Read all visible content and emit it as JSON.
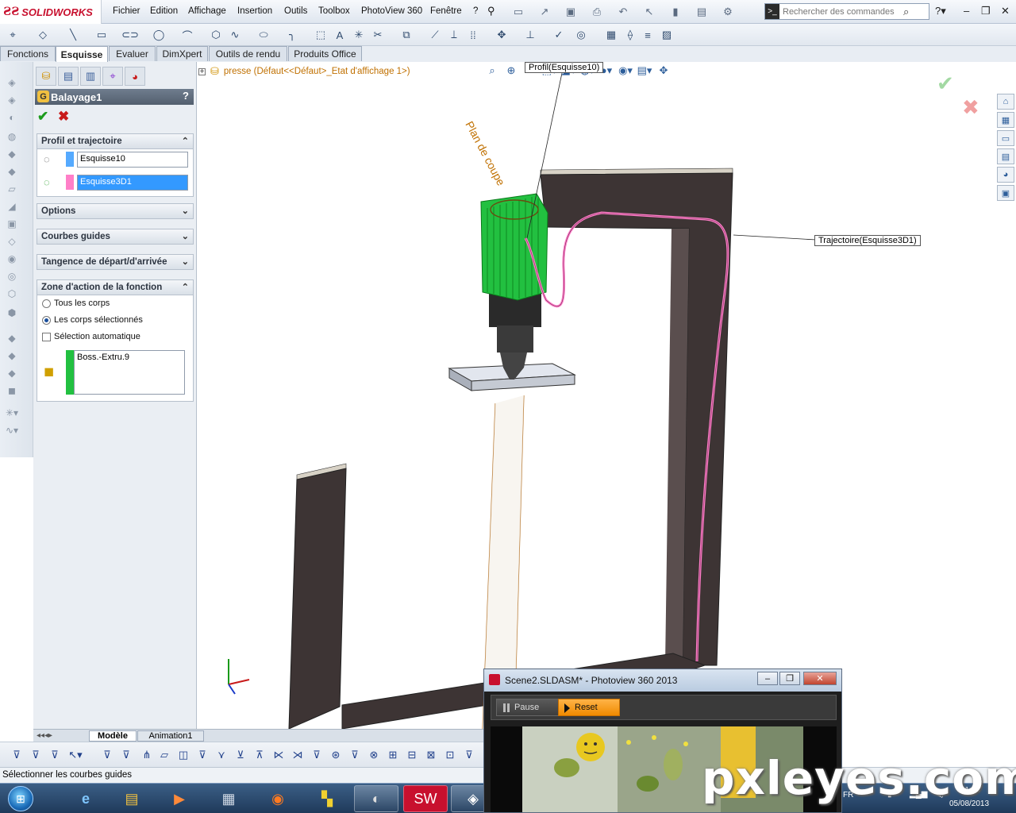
{
  "app": {
    "brand": "SOLIDWORKS",
    "menus": [
      "Fichier",
      "Edition",
      "Affichage",
      "Insertion",
      "Outils",
      "Toolbox",
      "PhotoView 360",
      "Fenêtre",
      "?"
    ],
    "search_placeholder": "Rechercher des commandes"
  },
  "tabs": [
    "Fonctions",
    "Esquisse",
    "Evaluer",
    "DimXpert",
    "Outils de rendu",
    "Produits Office"
  ],
  "active_tab": "Esquisse",
  "property_manager": {
    "title": "Balayage1",
    "help": "?",
    "sections": {
      "profile": {
        "title": "Profil et trajectoire",
        "profile_value": "Esquisse10",
        "path_value": "Esquisse3D1",
        "profile_color": "#55aaff",
        "path_color": "#ff7fc8"
      },
      "options": {
        "title": "Options"
      },
      "guides": {
        "title": "Courbes guides"
      },
      "tangency": {
        "title": "Tangence de départ/d'arrivée"
      },
      "scope": {
        "title": "Zone d'action de la fonction",
        "all_bodies": "Tous les corps",
        "selected_bodies": "Les corps sélectionnés",
        "auto_select": "Sélection automatique",
        "body": "Boss.-Extru.9",
        "body_color": "#22c040"
      }
    }
  },
  "graphics": {
    "tree_label": "presse  (Défaut<<Défaut>_Etat d'affichage 1>)",
    "callout_profile": "Profil(Esquisse10)",
    "callout_path": "Trajectoire(Esquisse3D1)",
    "frame_color": "#3d3434",
    "sweep_color": "#22c040"
  },
  "model_tabs": [
    "Modèle",
    "Animation1"
  ],
  "status_text": "Sélectionner les courbes guides",
  "photoview": {
    "title": "Scene2.SLDASM* - Photoview 360 2013",
    "pause_label": "Pause",
    "reset_label": "Reset"
  },
  "watermark": "pxleyes.com",
  "tray": {
    "lang": "FR",
    "time": "21:45",
    "date": "05/08/2013"
  }
}
